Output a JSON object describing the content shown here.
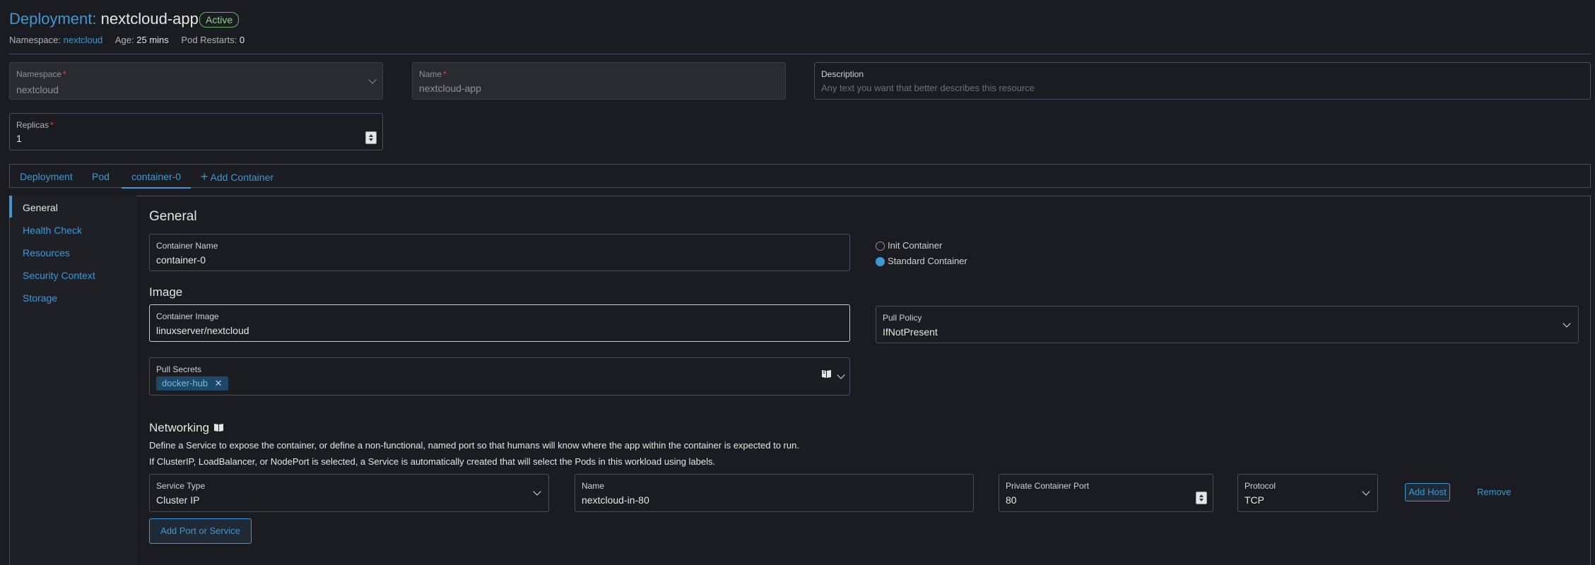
{
  "header": {
    "kind": "Deployment:",
    "name": "nextcloud-app",
    "status": "Active",
    "namespace_label": "Namespace:",
    "namespace_value": "nextcloud",
    "age_label": "Age:",
    "age_value": "25 mins",
    "restarts_label": "Pod Restarts:",
    "restarts_value": "0"
  },
  "meta": {
    "namespace": {
      "label": "Namespace",
      "value": "nextcloud"
    },
    "name": {
      "label": "Name",
      "value": "nextcloud-app"
    },
    "description": {
      "label": "Description",
      "placeholder": "Any text you want that better describes this resource"
    },
    "replicas": {
      "label": "Replicas",
      "value": "1"
    }
  },
  "tabs": [
    {
      "label": "Deployment"
    },
    {
      "label": "Pod"
    },
    {
      "label": "container-0"
    },
    {
      "label": "Add Container"
    }
  ],
  "sidenav": [
    {
      "label": "General"
    },
    {
      "label": "Health Check"
    },
    {
      "label": "Resources"
    },
    {
      "label": "Security Context"
    },
    {
      "label": "Storage"
    }
  ],
  "general": {
    "title": "General",
    "container_name": {
      "label": "Container Name",
      "value": "container-0"
    },
    "init_container": "Init Container",
    "standard_container": "Standard Container"
  },
  "image": {
    "title": "Image",
    "container_image": {
      "label": "Container Image",
      "value": "linuxserver/nextcloud"
    },
    "pull_policy": {
      "label": "Pull Policy",
      "value": "IfNotPresent"
    },
    "pull_secrets": {
      "label": "Pull Secrets",
      "chip": "docker-hub"
    }
  },
  "networking": {
    "title": "Networking",
    "desc1": "Define a Service to expose the container, or define a non-functional, named port so that humans will know where the app within the container is expected to run.",
    "desc2": "If ClusterIP, LoadBalancer, or NodePort is selected, a Service is automatically created that will select the Pods in this workload using labels.",
    "service_type": {
      "label": "Service Type",
      "value": "Cluster IP"
    },
    "port_name": {
      "label": "Name",
      "value": "nextcloud-in-80"
    },
    "container_port": {
      "label": "Private Container Port",
      "value": "80"
    },
    "protocol": {
      "label": "Protocol",
      "value": "TCP"
    },
    "add_host": "Add Host",
    "remove": "Remove",
    "add_port": "Add Port or Service"
  },
  "colors": {
    "accent": "#3d98d3",
    "background": "#1b1c21",
    "active_badge": "#5fb55f",
    "required": "#e5484d"
  }
}
